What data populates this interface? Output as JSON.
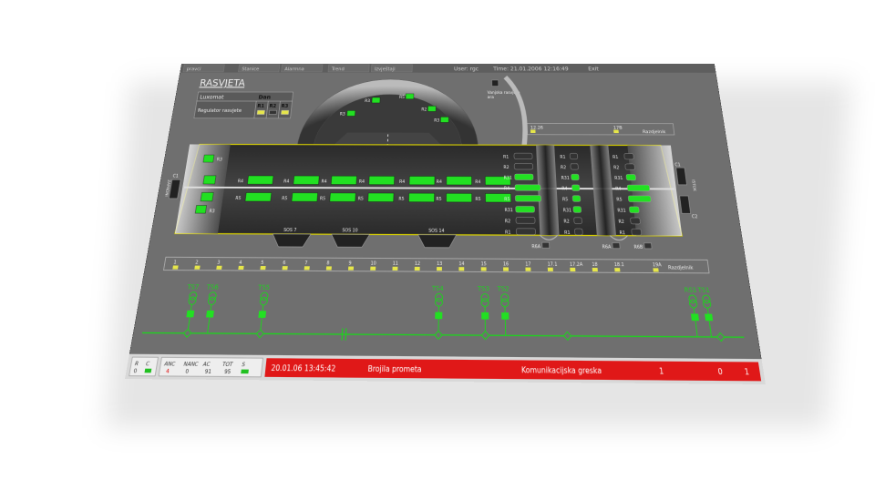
{
  "toolbar": {
    "items": [
      "pravci",
      "Stanice",
      "Alarmna",
      "Trend",
      "Izvještaji"
    ],
    "user_label": "User: rgc",
    "time_label": "Time: 21.01.2006 12:16:49",
    "exit_label": "Exit"
  },
  "header": {
    "title": "RASVJETA",
    "luxomat_label": "Luxomat",
    "luxomat_value": "Dan",
    "regulator_label": "Regulator rasvjete",
    "reg_columns": [
      "R1",
      "R2",
      "R3"
    ],
    "vanjska_label": "Vanjska rasvjeta",
    "vanjska_label2": "ara",
    "range_left": "12.26",
    "range_right": "17B",
    "razdjelnik_top": "Razdjelnik"
  },
  "arch_labels": [
    "R3",
    "R3",
    "R5",
    "R2",
    "R3"
  ],
  "tunnel": {
    "left_label_top": "R3",
    "row1_label": "R4",
    "row2_label": "R5",
    "left_label_bottom": "R3",
    "sos": [
      "SOS 7",
      "SOS 10",
      "SOS 14"
    ],
    "side_left": "C1",
    "side_left_vertical": "ZAPADNI",
    "side_right_c1": "C1",
    "side_right_c2": "C2",
    "side_right_vertical": "ISTOK",
    "mid_labels": [
      "R1",
      "R2",
      "R31",
      "R4",
      "R5",
      "R31",
      "R2",
      "R1"
    ],
    "right_labels": [
      "R1",
      "R2",
      "R31",
      "R4",
      "R5",
      "R31",
      "R2",
      "R1"
    ],
    "r6_labels": [
      "R6A",
      "R6A",
      "R6B"
    ]
  },
  "bus": {
    "numbers": [
      "1",
      "2",
      "3",
      "4",
      "5",
      "6",
      "7",
      "8",
      "9",
      "10",
      "11",
      "12",
      "13",
      "14",
      "15",
      "16",
      "17",
      "17.1",
      "17.2A",
      "18",
      "18.1",
      "19A"
    ],
    "label": "Razdjelnik"
  },
  "transformers": [
    "TS7",
    "TS6",
    "TS5",
    "TS4",
    "TS3",
    "TS2",
    "RS1",
    "TS1"
  ],
  "status": {
    "r_label": "R",
    "c_label": "C",
    "r_value": "0",
    "counters": [
      {
        "label": "ANC",
        "value": "4"
      },
      {
        "label": "NANC",
        "value": "0"
      },
      {
        "label": "AC",
        "value": "91"
      },
      {
        "label": "TOT",
        "value": "95"
      },
      {
        "label": "S",
        "value": ""
      }
    ],
    "alarm": {
      "datetime": "20.01.06 13:45:42",
      "source": "Brojila prometa",
      "message": "Komunikacijska greska",
      "v1": "1",
      "v2": "0",
      "v3": "1"
    }
  },
  "colors": {
    "panel_bg": "#6f6f6f",
    "lamp_on": "#22e022",
    "bus_yellow": "#e6e64a",
    "alarm_red": "#e01818",
    "line_green": "#20d020"
  }
}
